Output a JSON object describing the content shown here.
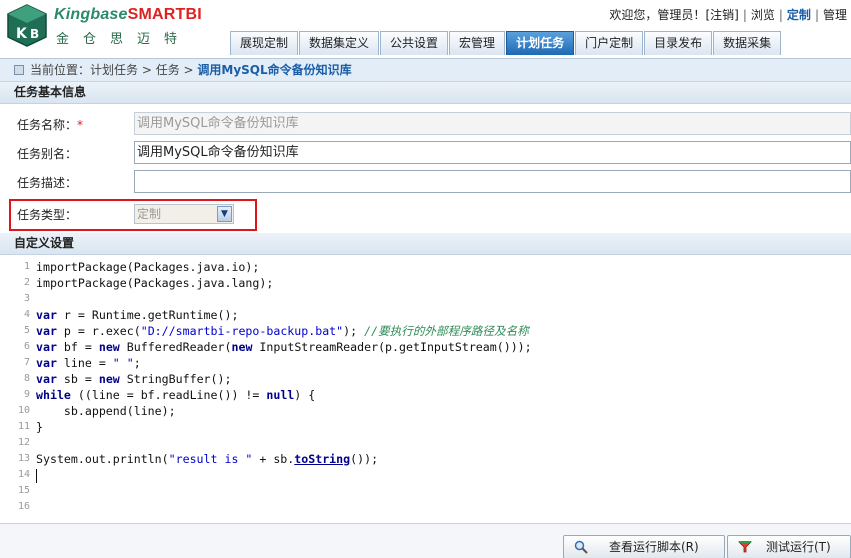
{
  "header": {
    "logo_text_1": "Kingbase",
    "logo_text_2": "SMARTBI",
    "logo_sub": "金仓思迈特",
    "welcome": "欢迎您，管理员！",
    "logout": "[注销]",
    "browse": "浏览",
    "customize": "定制",
    "manage": "管理"
  },
  "tabs": [
    {
      "label": "展现定制",
      "active": false
    },
    {
      "label": "数据集定义",
      "active": false
    },
    {
      "label": "公共设置",
      "active": false
    },
    {
      "label": "宏管理",
      "active": false
    },
    {
      "label": "计划任务",
      "active": true
    },
    {
      "label": "门户定制",
      "active": false
    },
    {
      "label": "目录发布",
      "active": false
    },
    {
      "label": "数据采集",
      "active": false
    }
  ],
  "breadcrumb": {
    "prefix": "当前位置：",
    "path": "计划任务 > 任务 > ",
    "current": "调用MySQL命令备份知识库"
  },
  "sections": {
    "basic": "任务基本信息",
    "custom": "自定义设置"
  },
  "form": {
    "name_label": "任务名称：",
    "name_required": "*",
    "name_value": "调用MySQL命令备份知识库",
    "alias_label": "任务别名：",
    "alias_value": "调用MySQL命令备份知识库",
    "desc_label": "任务描述：",
    "desc_value": "",
    "type_label": "任务类型：",
    "type_value": "定制"
  },
  "code_lines": [
    {
      "n": "1",
      "t": "importPackage(Packages.java.io);"
    },
    {
      "n": "2",
      "t": "importPackage(Packages.java.lang);"
    },
    {
      "n": "3",
      "t": ""
    },
    {
      "n": "4",
      "t": "var r = Runtime.getRuntime();"
    },
    {
      "n": "5",
      "t": "var p = r.exec(\"D://smartbi-repo-backup.bat\"); //要执行的外部程序路径及名称"
    },
    {
      "n": "6",
      "t": "var bf = new BufferedReader(new InputStreamReader(p.getInputStream()));"
    },
    {
      "n": "7",
      "t": "var line = \" \";"
    },
    {
      "n": "8",
      "t": "var sb = new StringBuffer();"
    },
    {
      "n": "9",
      "t": "while ((line = bf.readLine()) != null) {"
    },
    {
      "n": "10",
      "t": "    sb.append(line);"
    },
    {
      "n": "11",
      "t": "}"
    },
    {
      "n": "12",
      "t": ""
    },
    {
      "n": "13",
      "t": "System.out.println(\"result is \" + sb.toString());"
    },
    {
      "n": "14",
      "t": ""
    },
    {
      "n": "15",
      "t": ""
    },
    {
      "n": "16",
      "t": ""
    }
  ],
  "buttons": {
    "view_script": "查看运行脚本(R)",
    "test_run": "测试运行(T)"
  },
  "colors": {
    "accent": "#1d69b4",
    "highlight": "#e0141c",
    "keyword": "#00008b",
    "string": "#0000cc",
    "comment": "#2e8b57"
  }
}
